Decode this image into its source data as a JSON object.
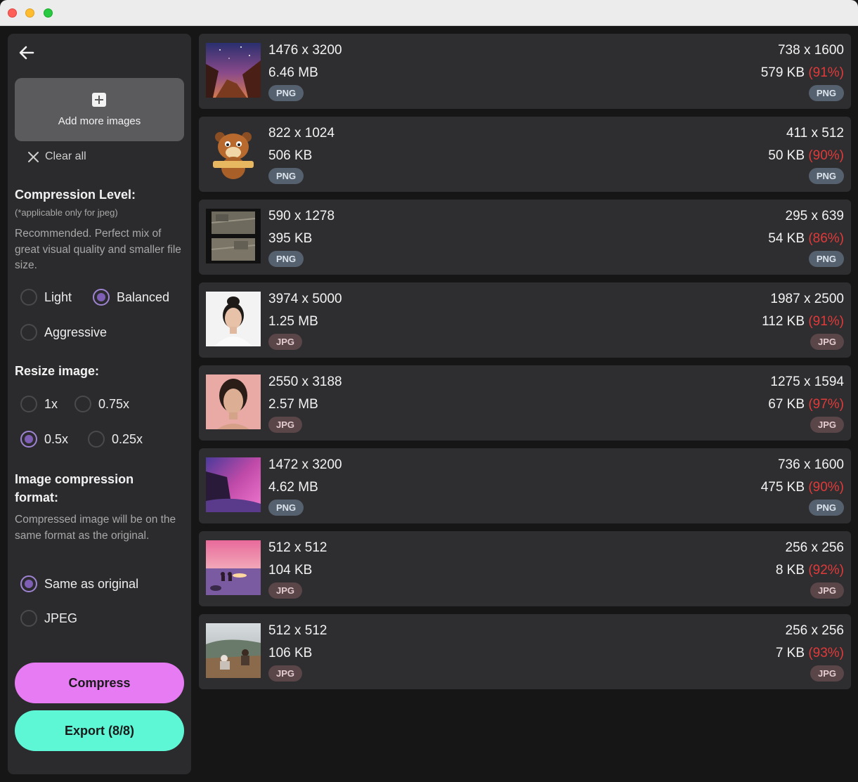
{
  "sidebar": {
    "add_more_label": "Add more images",
    "clear_all_label": "Clear all",
    "compression_level": {
      "title": "Compression Level:",
      "note": "(*applicable only for jpeg)",
      "description": "Recommended. Perfect mix of great visual quality and smaller file size.",
      "options": [
        {
          "label": "Light",
          "selected": false
        },
        {
          "label": "Balanced",
          "selected": true
        },
        {
          "label": "Aggressive",
          "selected": false
        }
      ]
    },
    "resize": {
      "title": "Resize image:",
      "options": [
        {
          "label": "1x",
          "selected": false
        },
        {
          "label": "0.75x",
          "selected": false
        },
        {
          "label": "0.5x",
          "selected": true
        },
        {
          "label": "0.25x",
          "selected": false
        }
      ]
    },
    "format": {
      "title": "Image compression format:",
      "description": "Compressed image will be on the same format as the original.",
      "options": [
        {
          "label": "Same as original",
          "selected": true
        },
        {
          "label": "JPEG",
          "selected": false
        }
      ]
    },
    "compress_label": "Compress",
    "export_label": "Export (8/8)"
  },
  "images": [
    {
      "dims": "1476 x 3200",
      "size": "6.46 MB",
      "format": "PNG",
      "out_dims": "738 x 1600",
      "out_size": "579 KB",
      "reduction": "(91%)"
    },
    {
      "dims": "822 x 1024",
      "size": "506 KB",
      "format": "PNG",
      "out_dims": "411 x 512",
      "out_size": "50 KB",
      "reduction": "(90%)"
    },
    {
      "dims": "590 x 1278",
      "size": "395 KB",
      "format": "PNG",
      "out_dims": "295 x 639",
      "out_size": "54 KB",
      "reduction": "(86%)"
    },
    {
      "dims": "3974 x 5000",
      "size": "1.25 MB",
      "format": "JPG",
      "out_dims": "1987 x 2500",
      "out_size": "112 KB",
      "reduction": "(91%)"
    },
    {
      "dims": "2550 x 3188",
      "size": "2.57 MB",
      "format": "JPG",
      "out_dims": "1275 x 1594",
      "out_size": "67 KB",
      "reduction": "(97%)"
    },
    {
      "dims": "1472 x 3200",
      "size": "4.62 MB",
      "format": "PNG",
      "out_dims": "736 x 1600",
      "out_size": "475 KB",
      "reduction": "(90%)"
    },
    {
      "dims": "512 x 512",
      "size": "104 KB",
      "format": "JPG",
      "out_dims": "256 x 256",
      "out_size": "8 KB",
      "reduction": "(92%)"
    },
    {
      "dims": "512 x 512",
      "size": "106 KB",
      "format": "JPG",
      "out_dims": "256 x 256",
      "out_size": "7 KB",
      "reduction": "(93%)"
    }
  ],
  "colors": {
    "compress": "#e67bf3",
    "export": "#5ef7d6",
    "reduction": "#e03a3a",
    "radio_selected": "#7e5fb5"
  }
}
